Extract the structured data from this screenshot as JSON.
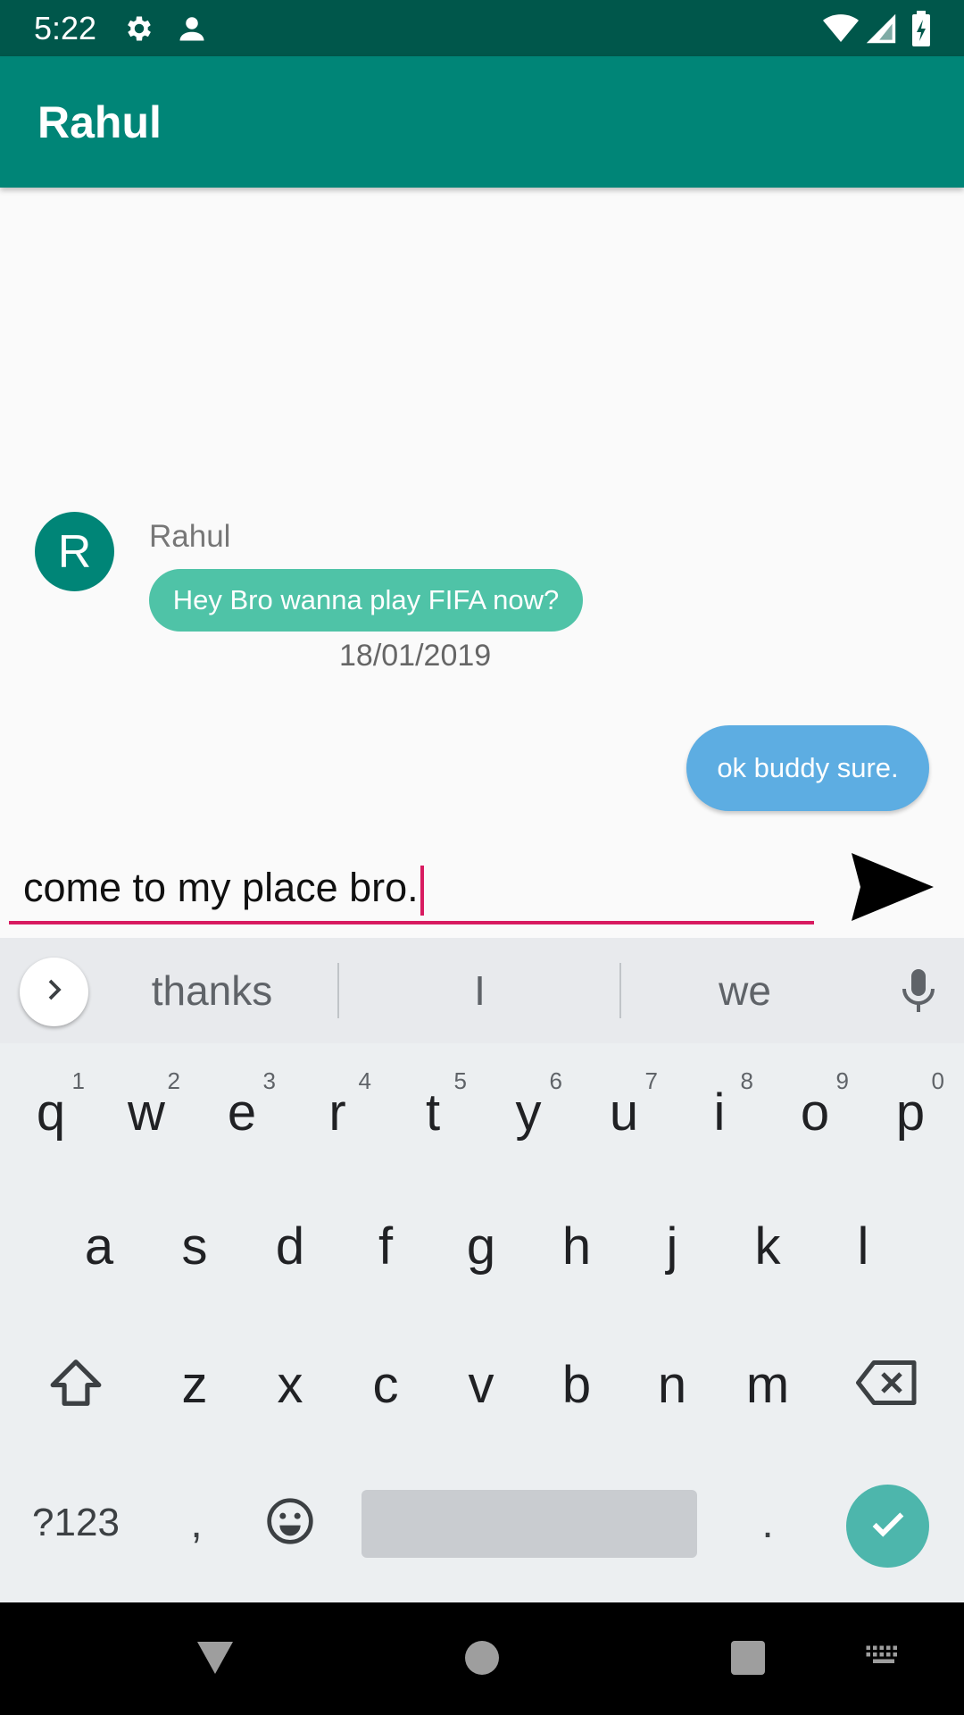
{
  "status_bar": {
    "time": "5:22",
    "icons": [
      "settings-icon",
      "account-icon",
      "wifi-icon",
      "signal-icon",
      "battery-charging-icon"
    ]
  },
  "app_bar": {
    "title": "Rahul"
  },
  "chat": {
    "incoming": {
      "avatar_letter": "R",
      "sender": "Rahul",
      "text": "Hey Bro wanna play FIFA now?",
      "date": "18/01/2019"
    },
    "outgoing": {
      "text": "ok buddy sure."
    }
  },
  "composer": {
    "value": "come to my place bro.",
    "send_icon": "send-icon"
  },
  "keyboard": {
    "suggestions": [
      "thanks",
      "I",
      "we"
    ],
    "row1": [
      {
        "k": "q",
        "n": "1"
      },
      {
        "k": "w",
        "n": "2"
      },
      {
        "k": "e",
        "n": "3"
      },
      {
        "k": "r",
        "n": "4"
      },
      {
        "k": "t",
        "n": "5"
      },
      {
        "k": "y",
        "n": "6"
      },
      {
        "k": "u",
        "n": "7"
      },
      {
        "k": "i",
        "n": "8"
      },
      {
        "k": "o",
        "n": "9"
      },
      {
        "k": "p",
        "n": "0"
      }
    ],
    "row2": [
      "a",
      "s",
      "d",
      "f",
      "g",
      "h",
      "j",
      "k",
      "l"
    ],
    "row3": [
      "z",
      "x",
      "c",
      "v",
      "b",
      "n",
      "m"
    ],
    "symbols_label": "?123",
    "comma": ",",
    "period": "."
  },
  "colors": {
    "status_bar": "#00574b",
    "app_bar": "#008577",
    "accent": "#d81b60",
    "incoming_bubble": "#4fc3a7",
    "outgoing_bubble": "#5dade2"
  }
}
